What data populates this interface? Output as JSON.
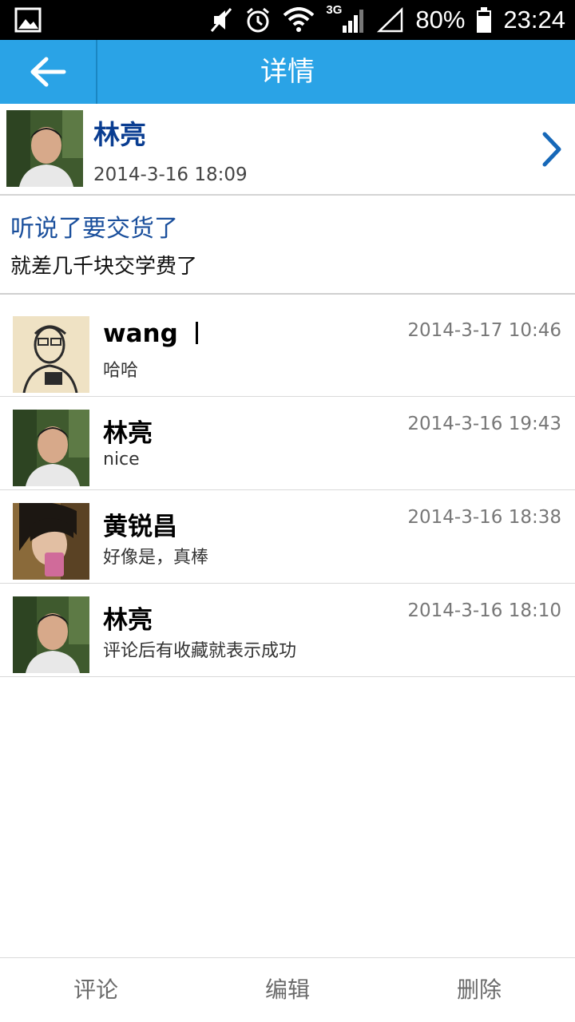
{
  "status_bar": {
    "battery": "80%",
    "time": "23:24",
    "network": "3G",
    "icons": [
      "gallery-icon",
      "mute-icon",
      "alarm-icon",
      "wifi-icon",
      "signal-icon",
      "signal-empty-icon",
      "battery-icon"
    ]
  },
  "header": {
    "title": "详情",
    "back_icon": "back-arrow-icon"
  },
  "post": {
    "author": "林亮",
    "date": "2014-3-16 18:09",
    "title": "听说了要交货了",
    "text": "就差几千块交学费了"
  },
  "comments": [
    {
      "name": "wang",
      "time": "2014-3-17 10:46",
      "text": "哈哈"
    },
    {
      "name": "林亮",
      "time": "2014-3-16 19:43",
      "text": "nice"
    },
    {
      "name": "黄锐昌",
      "time": "2014-3-16 18:38",
      "text": "好像是，真棒"
    },
    {
      "name": "林亮",
      "time": "2014-3-16 18:10",
      "text": "评论后有收藏就表示成功"
    }
  ],
  "bottom_bar": {
    "comment": "评论",
    "edit": "编辑",
    "delete": "删除"
  },
  "colors": {
    "title_bar": "#2aa3e6",
    "author_name": "#0a3d91",
    "post_title": "#1a4f9c"
  }
}
